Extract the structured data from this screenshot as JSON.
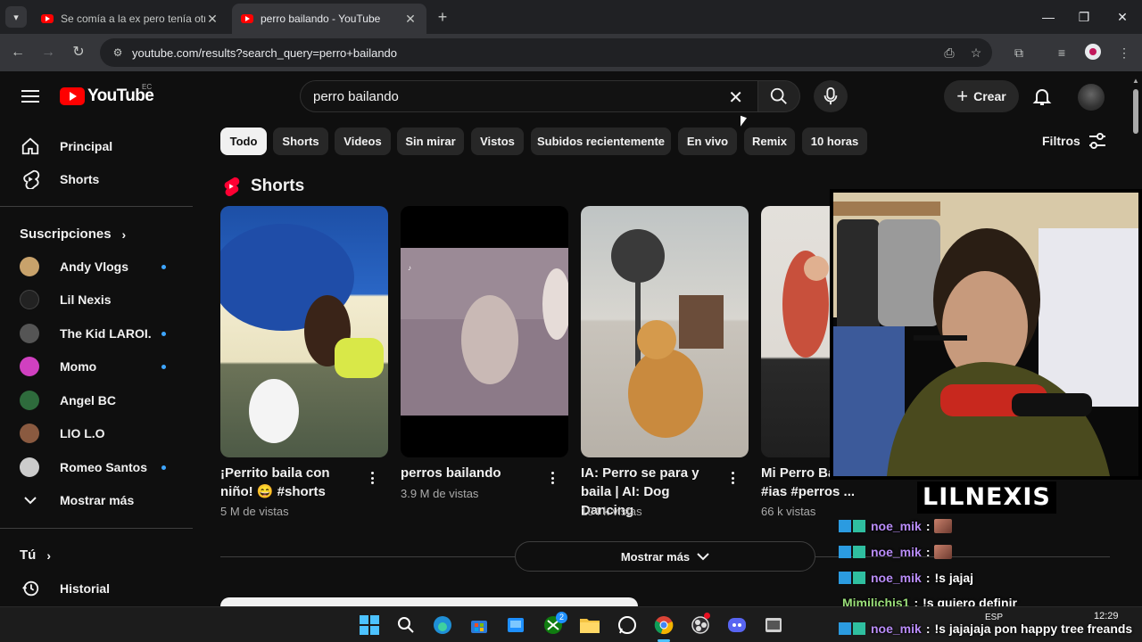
{
  "browser": {
    "tabs": [
      {
        "title": "Se comía a la ex pero tenía otro",
        "active": false
      },
      {
        "title": "perro bailando - YouTube",
        "active": true
      }
    ],
    "url": "youtube.com/results?search_query=perro+bailando"
  },
  "header": {
    "logo_text": "YouTube",
    "country_code": "EC",
    "search_value": "perro bailando",
    "create_label": "Crear"
  },
  "sidebar": {
    "main": [
      {
        "label": "Principal",
        "icon": "home-icon"
      },
      {
        "label": "Shorts",
        "icon": "shorts-icon"
      }
    ],
    "subscriptions_title": "Suscripciones",
    "subscriptions": [
      {
        "label": "Andy Vlogs",
        "live": true,
        "color": "#c8a26b"
      },
      {
        "label": "Lil Nexis",
        "live": false,
        "color": "#222222"
      },
      {
        "label": "The Kid LAROI.",
        "live": true,
        "color": "#555555"
      },
      {
        "label": "Momo",
        "live": true,
        "color": "#d040c0"
      },
      {
        "label": "Angel BC",
        "live": false,
        "color": "#2e6b3c"
      },
      {
        "label": "LIO L.O",
        "live": false,
        "color": "#8a5a40"
      },
      {
        "label": "Romeo Santos",
        "live": true,
        "color": "#cccccc"
      }
    ],
    "show_more": "Mostrar más",
    "you_title": "Tú",
    "history": "Historial"
  },
  "chips": [
    "Todo",
    "Shorts",
    "Videos",
    "Sin mirar",
    "Vistos",
    "Subidos recientemente",
    "En vivo",
    "Remix",
    "10 horas"
  ],
  "filters_label": "Filtros",
  "shorts": {
    "section_title": "Shorts",
    "items": [
      {
        "title": "¡Perrito baila con niño! 😄 #shorts",
        "views": "5 M de vistas"
      },
      {
        "title": "perros bailando",
        "views": "3.9 M de vistas"
      },
      {
        "title": "IA: Perro se para y baila | AI: Dog Dancing",
        "views": "104 k vistas"
      },
      {
        "title": "Mi Perro Ba ia #ias #perros ...",
        "views": "66 k vistas"
      }
    ],
    "show_more": "Mostrar más"
  },
  "overlay": {
    "streamer_name": "LILNEXIS",
    "chat": [
      {
        "user": "noe_mik",
        "message": "",
        "emote": true,
        "user_color": "#b98cf8"
      },
      {
        "user": "noe_mik",
        "message": "",
        "emote": true,
        "user_color": "#b98cf8"
      },
      {
        "user": "noe_mik",
        "message": "!s jajaj",
        "emote": false,
        "user_color": "#b98cf8"
      },
      {
        "user": "Mimilichis1",
        "message": "!s quiero definir",
        "emote": false,
        "user_color": "#9be07a"
      },
      {
        "user": "noe_mik",
        "message": "!s jajajaja pon happy tree freands",
        "emote": false,
        "user_color": "#b98cf8"
      }
    ]
  },
  "taskbar": {
    "lang": "ESP",
    "time": "12:29",
    "xbox_badge": "2"
  }
}
